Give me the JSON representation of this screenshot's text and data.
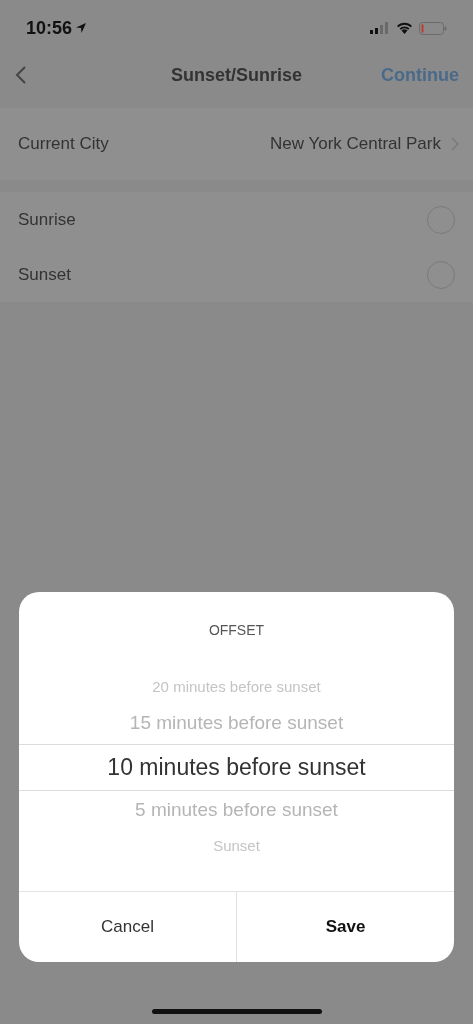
{
  "status_bar": {
    "time": "10:56"
  },
  "nav": {
    "title": "Sunset/Sunrise",
    "action": "Continue"
  },
  "city": {
    "label": "Current City",
    "value": "New York Central Park"
  },
  "options": [
    {
      "label": "Sunrise",
      "selected": false
    },
    {
      "label": "Sunset",
      "selected": false
    }
  ],
  "sheet": {
    "title": "OFFSET",
    "picker": [
      {
        "label": "20 minutes before sunset",
        "selected": false
      },
      {
        "label": "15 minutes before sunset",
        "selected": false
      },
      {
        "label": "10 minutes before sunset",
        "selected": true
      },
      {
        "label": "5 minutes before sunset",
        "selected": false
      },
      {
        "label": "Sunset",
        "selected": false
      }
    ],
    "buttons": [
      {
        "label": "Cancel",
        "kind": "secondary"
      },
      {
        "label": "Save",
        "kind": "primary"
      }
    ]
  }
}
